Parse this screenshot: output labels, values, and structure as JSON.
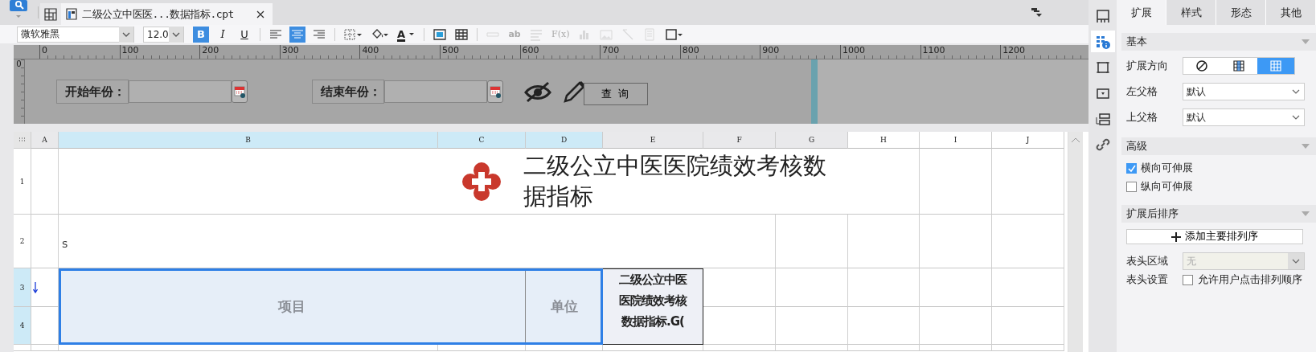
{
  "tabs": [
    {
      "label": "二级公立中医医...数据指标.cpt",
      "selected": true
    }
  ],
  "toolbar": {
    "font": "微软雅黑",
    "size": "12.0",
    "groups": [
      [
        {
          "kind": "bold",
          "label": "B",
          "selected": true,
          "disabled": false
        },
        {
          "kind": "italic",
          "label": "I",
          "selected": false,
          "disabled": false
        },
        {
          "kind": "underline",
          "label": "U",
          "selected": false,
          "disabled": false
        }
      ],
      [
        {
          "kind": "align-left",
          "selected": false,
          "disabled": false
        },
        {
          "kind": "align-center",
          "selected": true,
          "disabled": false
        },
        {
          "kind": "align-right",
          "selected": false,
          "disabled": false
        }
      ],
      [
        {
          "kind": "border",
          "selected": false,
          "disabled": false
        },
        {
          "kind": "fill",
          "selected": false,
          "disabled": false
        },
        {
          "kind": "font-color",
          "label": "A",
          "selected": false,
          "disabled": false
        }
      ],
      [
        {
          "kind": "merge",
          "selected": false,
          "disabled": false
        },
        {
          "kind": "table",
          "selected": false,
          "disabled": false
        }
      ],
      [
        {
          "kind": "textfield",
          "selected": false,
          "disabled": true
        },
        {
          "kind": "text",
          "label": "ab",
          "selected": false,
          "disabled": true
        },
        {
          "kind": "lines",
          "selected": false,
          "disabled": true
        },
        {
          "kind": "formula",
          "label": "F(x)",
          "selected": false,
          "disabled": true
        },
        {
          "kind": "chart",
          "selected": false,
          "disabled": true
        },
        {
          "kind": "image",
          "selected": false,
          "disabled": true
        },
        {
          "kind": "slash",
          "selected": false,
          "disabled": true
        },
        {
          "kind": "doc",
          "selected": false,
          "disabled": true
        },
        {
          "kind": "frame",
          "selected": false,
          "disabled": false
        }
      ]
    ]
  },
  "param_pane": {
    "ruler": [
      "0",
      "100",
      "200",
      "300",
      "400",
      "500",
      "600",
      "700",
      "800",
      "900",
      "1000",
      "1100",
      "1200"
    ],
    "vertical_ruler": "0",
    "widgets": [
      {
        "kind": "label",
        "text": "开始年份："
      },
      {
        "kind": "date"
      },
      {
        "kind": "label",
        "text": "结束年份："
      },
      {
        "kind": "date"
      },
      {
        "kind": "hidden"
      },
      {
        "kind": "edit"
      },
      {
        "kind": "button",
        "text": "查 询"
      }
    ]
  },
  "sheet": {
    "columns": [
      {
        "label": "A",
        "selected": false,
        "shaded": true
      },
      {
        "label": "B",
        "selected": true,
        "shaded": false
      },
      {
        "label": "C",
        "selected": true,
        "shaded": false
      },
      {
        "label": "D",
        "selected": true,
        "shaded": false
      },
      {
        "label": "E",
        "selected": false,
        "shaded": true
      },
      {
        "label": "F",
        "selected": false,
        "shaded": true
      },
      {
        "label": "G",
        "selected": false,
        "shaded": true
      },
      {
        "label": "H",
        "selected": false,
        "shaded": false
      },
      {
        "label": "I",
        "selected": false,
        "shaded": false
      },
      {
        "label": "J",
        "selected": false,
        "shaded": false
      }
    ],
    "rows": [
      {
        "label": "1",
        "selected": false
      },
      {
        "label": "2",
        "selected": false
      },
      {
        "label": "3",
        "selected": true
      },
      {
        "label": "4",
        "selected": true
      }
    ],
    "cells": [
      {
        "kind": "title",
        "text": "二级公立中医医院绩效考核数据指标",
        "selected": false
      },
      {
        "kind": "text",
        "text": "s",
        "selected": false
      },
      {
        "kind": "marker",
        "selected": false
      },
      {
        "kind": "header",
        "text": "项目",
        "selected": true
      },
      {
        "kind": "header",
        "text": "单位",
        "selected": true
      },
      {
        "kind": "formula",
        "lines": [
          "二级公立中医",
          "医院绩效考核",
          "数据指标.G("
        ],
        "selected": false
      }
    ]
  },
  "side_icons": [
    {
      "kind": "layout",
      "selected": false
    },
    {
      "kind": "cell-attr",
      "selected": true
    },
    {
      "kind": "frame",
      "selected": false
    },
    {
      "kind": "widget",
      "selected": false
    },
    {
      "kind": "form",
      "selected": false
    },
    {
      "kind": "link",
      "selected": false
    }
  ],
  "panel": {
    "tabs": [
      {
        "label": "扩展",
        "selected": true
      },
      {
        "label": "样式",
        "selected": false
      },
      {
        "label": "形态",
        "selected": false
      },
      {
        "label": "其他",
        "selected": false
      }
    ],
    "sections": [
      {
        "title": "基本",
        "rows": [
          {
            "kind": "segments",
            "label": "扩展方向",
            "options": [
              {
                "kind": "none",
                "selected": false
              },
              {
                "kind": "vertical",
                "selected": false
              },
              {
                "kind": "horizontal",
                "selected": true
              }
            ]
          },
          {
            "kind": "select",
            "label": "左父格",
            "value": "默认",
            "disabled": false
          },
          {
            "kind": "select",
            "label": "上父格",
            "value": "默认",
            "disabled": false
          }
        ]
      },
      {
        "title": "高级",
        "rows": [
          {
            "kind": "checkbox",
            "label": "横向可伸展",
            "checked": true
          },
          {
            "kind": "checkbox",
            "label": "纵向可伸展",
            "checked": false
          }
        ]
      },
      {
        "title": "扩展后排序",
        "rows": [
          {
            "kind": "add-button",
            "label": "添加主要排列序"
          },
          {
            "kind": "select",
            "label": "表头区域",
            "value": "无",
            "disabled": true
          },
          {
            "kind": "labeled-checkbox",
            "label": "表头设置",
            "text": "允许用户点击排列顺序",
            "checked": false
          }
        ]
      }
    ]
  }
}
